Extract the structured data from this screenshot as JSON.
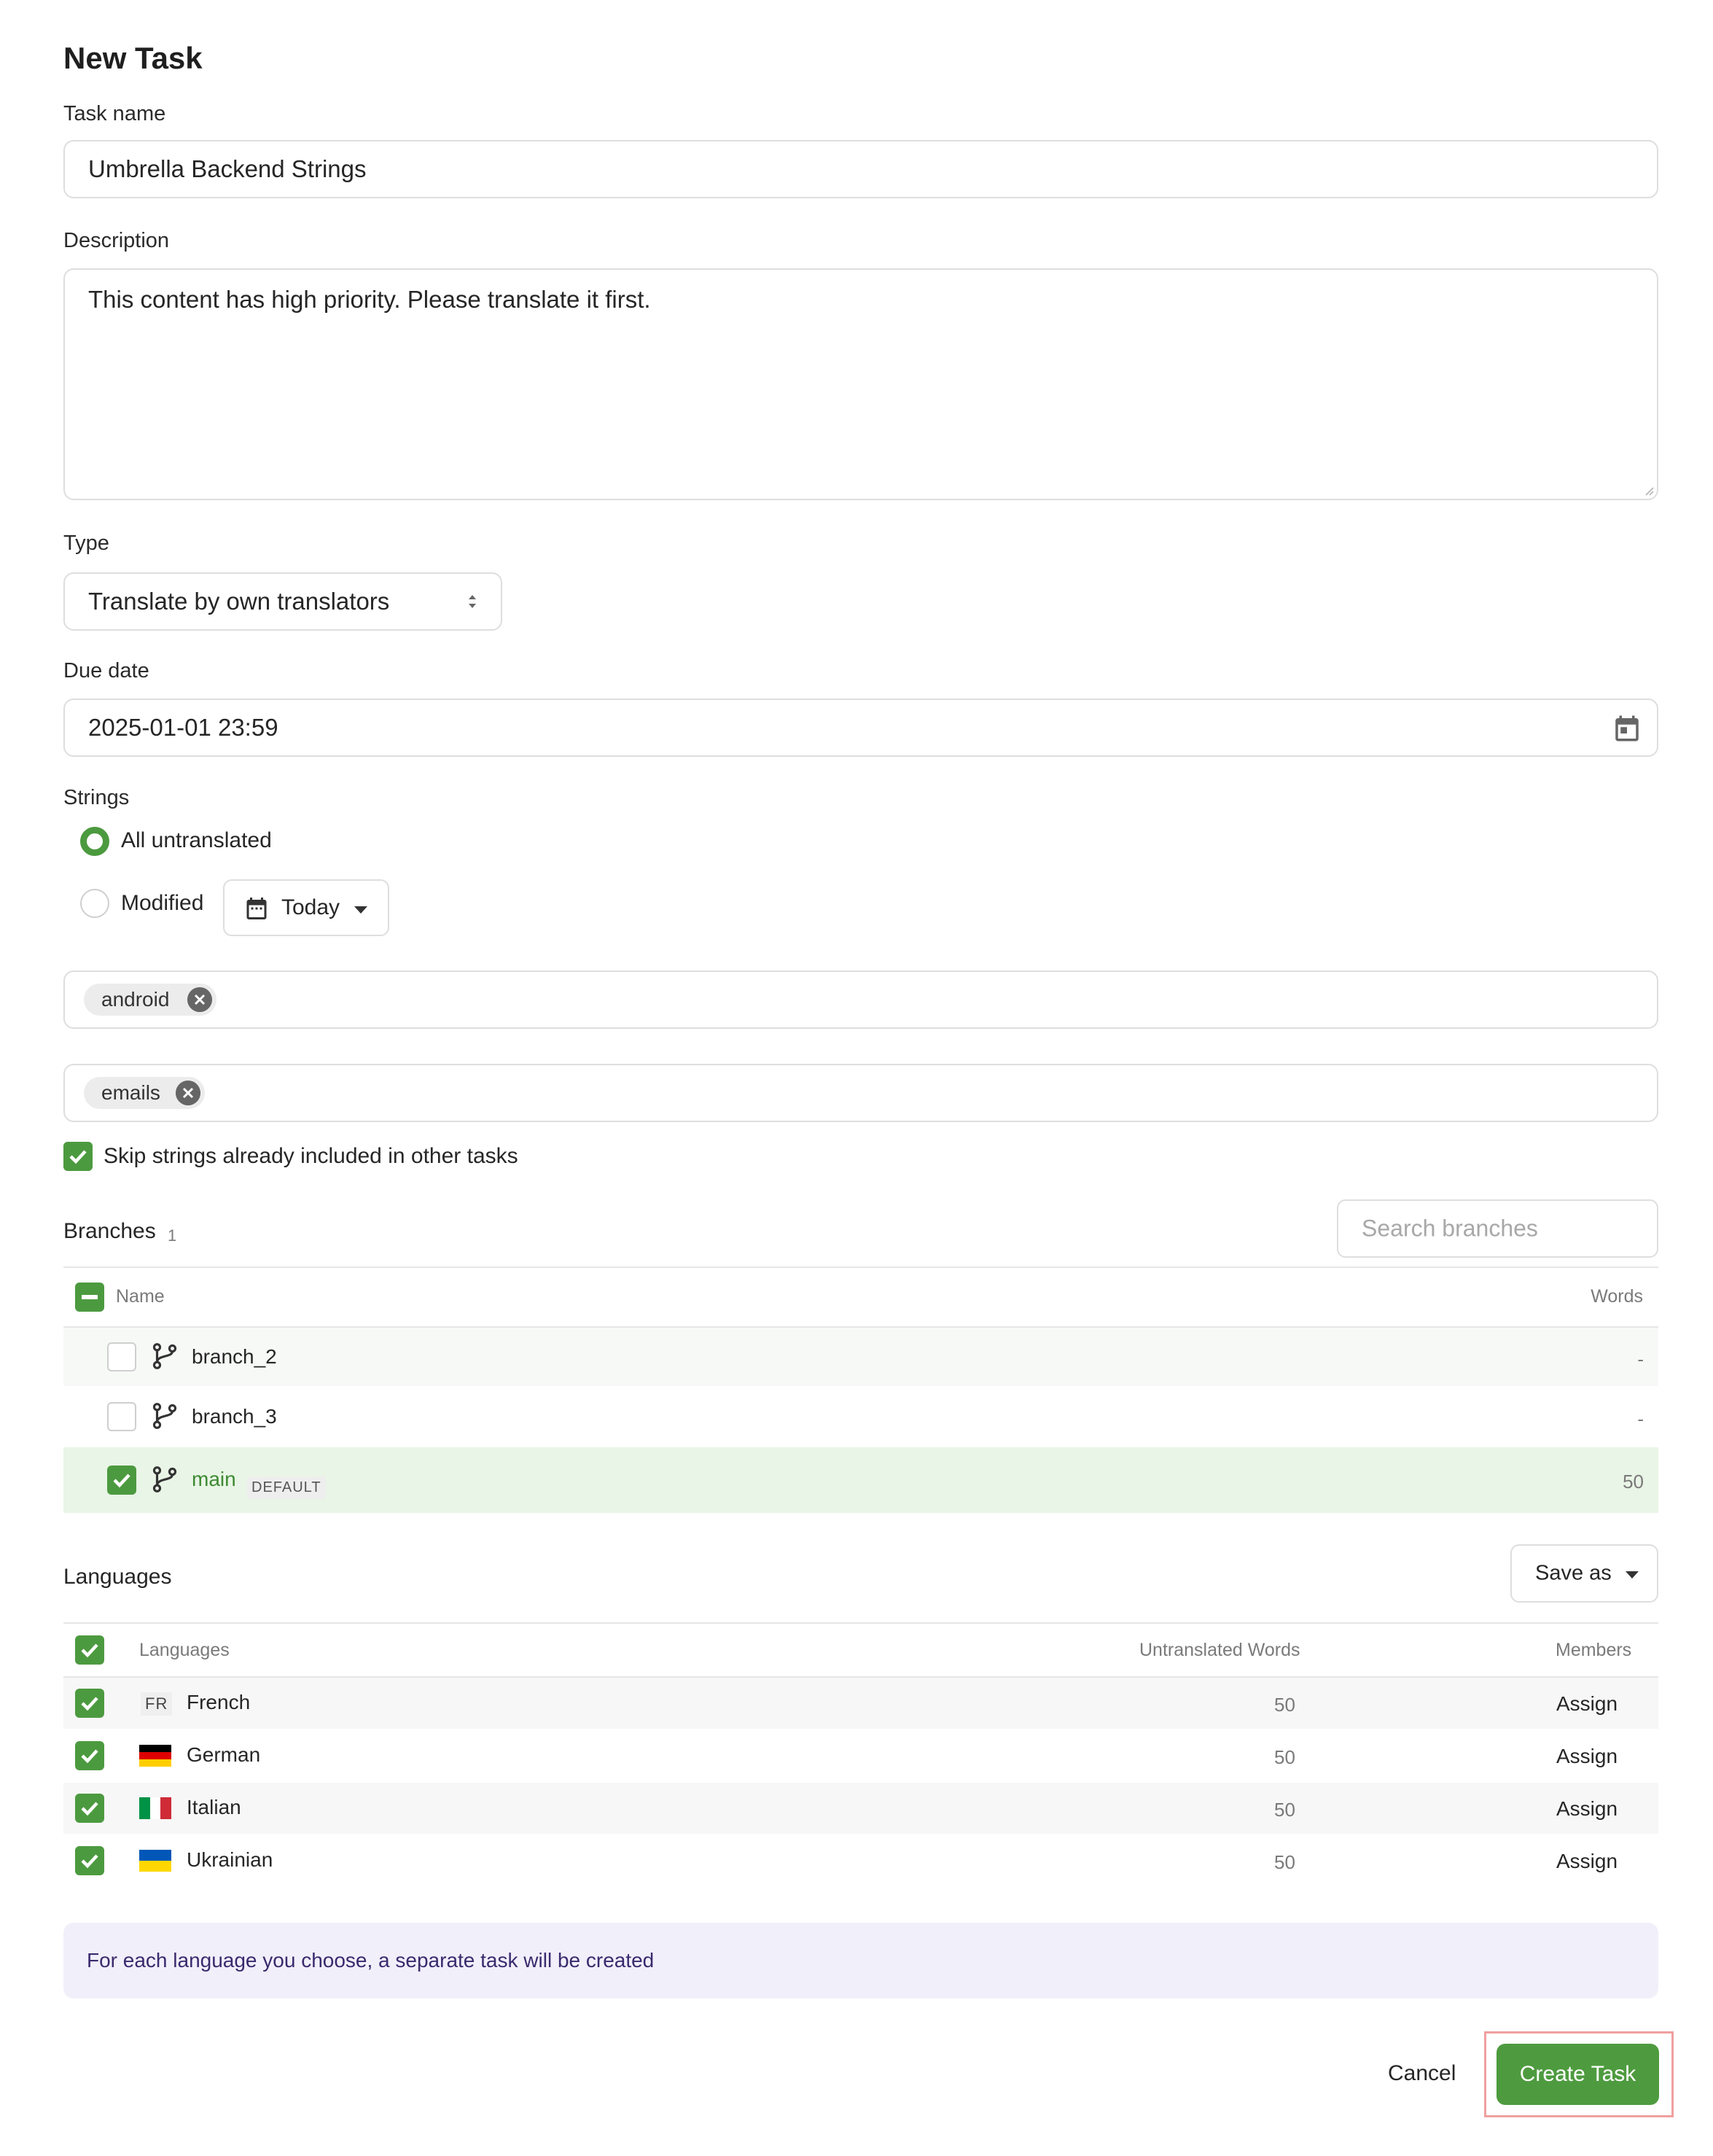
{
  "title": "New Task",
  "task_name": {
    "label": "Task name",
    "value": "Umbrella Backend Strings"
  },
  "description": {
    "label": "Description",
    "value": "This content has high priority. Please translate it first."
  },
  "type": {
    "label": "Type",
    "value": "Translate by own translators"
  },
  "due_date": {
    "label": "Due date",
    "value": "2025-01-01 23:59"
  },
  "strings": {
    "label": "Strings",
    "options": [
      {
        "label": "All untranslated",
        "selected": true
      },
      {
        "label": "Modified",
        "selected": false
      }
    ],
    "modified_range": "Today"
  },
  "tags": {
    "labels": [
      "android"
    ],
    "files": [
      "emails"
    ]
  },
  "skip_option": {
    "label": "Skip strings already included in other tasks",
    "checked": true
  },
  "branches": {
    "title": "Branches",
    "count": "1",
    "search_placeholder": "Search branches",
    "col_name": "Name",
    "col_words": "Words",
    "rows": [
      {
        "name": "branch_2",
        "words": "-",
        "checked": false
      },
      {
        "name": "branch_3",
        "words": "-",
        "checked": false
      },
      {
        "name": "main",
        "badge": "DEFAULT",
        "words": "50",
        "checked": true
      }
    ]
  },
  "languages": {
    "title": "Languages",
    "save_as": "Save as",
    "col_languages": "Languages",
    "col_untranslated": "Untranslated Words",
    "col_members": "Members",
    "rows": [
      {
        "code": "FR",
        "name": "French",
        "words": "50",
        "action": "Assign"
      },
      {
        "name": "German",
        "words": "50",
        "action": "Assign"
      },
      {
        "name": "Italian",
        "words": "50",
        "action": "Assign"
      },
      {
        "name": "Ukrainian",
        "words": "50",
        "action": "Assign"
      }
    ]
  },
  "info_text": "For each language you choose, a separate task will be created",
  "actions": {
    "cancel": "Cancel",
    "create": "Create Task"
  },
  "colors": {
    "accent": "#4e9b3f",
    "selected_row": "#e9f5e6",
    "info_bg": "#f1effa"
  }
}
